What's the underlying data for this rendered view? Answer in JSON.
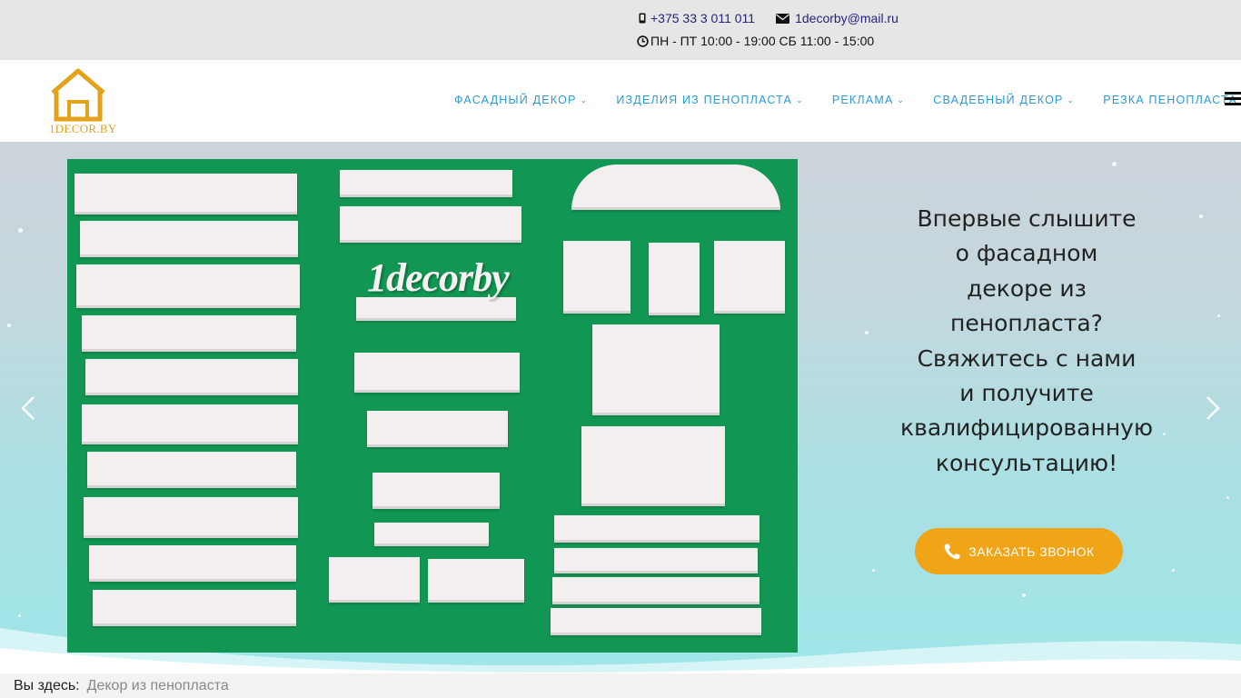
{
  "contacts": {
    "phone": "+375 33 3 011 011",
    "email": "1decorby@mail.ru",
    "hours": "ПН - ПТ 10:00 - 19:00 СБ 11:00 - 15:00"
  },
  "logo": {
    "text": "1DECOR.BY",
    "color": "#e3a21a"
  },
  "nav": {
    "items": [
      {
        "label": "Фасадный декор",
        "has_dropdown": true
      },
      {
        "label": "Изделия из пенопласта",
        "has_dropdown": true
      },
      {
        "label": "Реклама",
        "has_dropdown": true
      },
      {
        "label": "Свадебный декор",
        "has_dropdown": true
      },
      {
        "label": "Резка пенопласта",
        "has_dropdown": false
      }
    ],
    "accent_color": "#2a9bd7"
  },
  "hero": {
    "photo_caption": "1decorby",
    "lines": [
      "Впервые слышите",
      "о фасадном",
      "декоре из",
      "пенопласта?",
      "Свяжитесь с нами",
      "и получите",
      "квалифицированную",
      "консультацию!"
    ],
    "cta_label": "ЗАКАЗАТЬ ЗВОНОК",
    "cta_color": "#f0a418"
  },
  "breadcrumb": {
    "label": "Вы здесь:",
    "current": "Декор из пенопласта"
  }
}
